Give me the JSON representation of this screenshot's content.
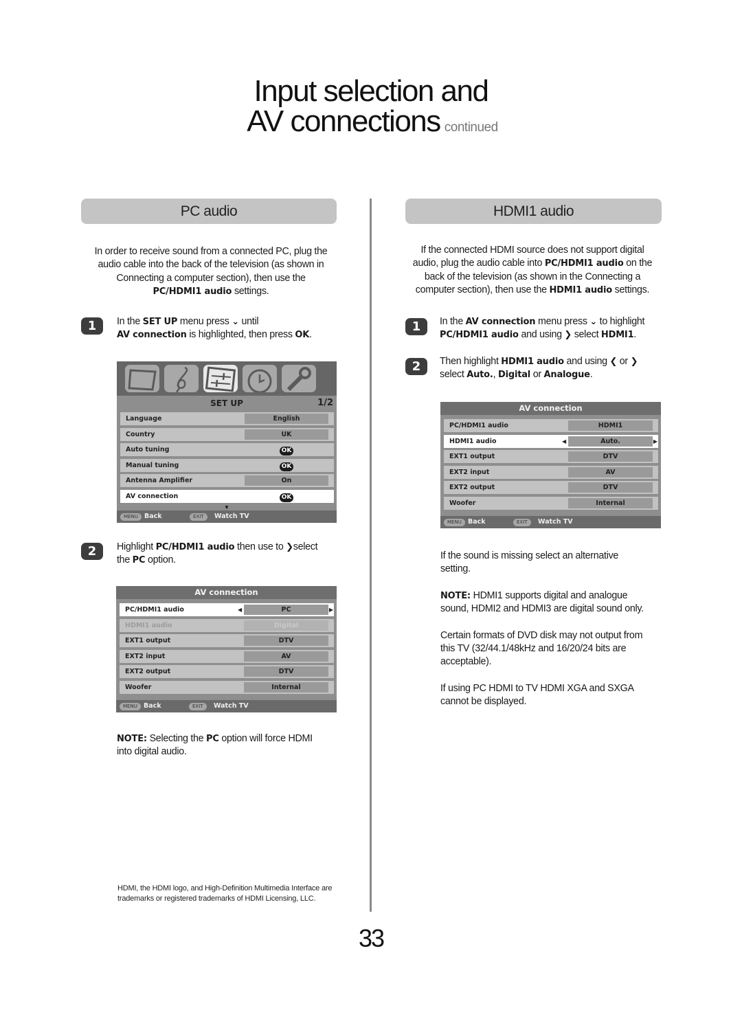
{
  "title": {
    "line1": "Input selection and",
    "line2": "AV connections",
    "suffix": "continued"
  },
  "left": {
    "heading": "PC audio",
    "intro": {
      "t1": "In order to receive sound from a connected PC, plug the",
      "t2": "audio cable into the back of the television (as shown in",
      "t3": "Connecting a computer   section), then use the",
      "b1": "PC/HDMI1 audio",
      "t4": " settings."
    },
    "step1": {
      "num": "1",
      "t1": "In the ",
      "b1": "SET UP",
      "t2": " menu press ",
      "icon": "down-chevron",
      "t3": " until",
      "b2": "AV connection",
      "t4": " is highlighted, then press  ",
      "b3": "OK",
      "t5": "."
    },
    "setup_menu": {
      "tabs": [
        "tv-icon",
        "music-clef-icon",
        "setup-sliders-icon",
        "clock-icon",
        "wrench-icon"
      ],
      "active_tab": 2,
      "title": "SET UP",
      "page": "1/2",
      "rows": [
        {
          "label": "Language",
          "value": "English"
        },
        {
          "label": "Country",
          "value": "UK"
        },
        {
          "label": "Auto tuning",
          "value": "OK"
        },
        {
          "label": "Manual tuning",
          "value": "OK"
        },
        {
          "label": "Antenna Amplifier",
          "value": "On"
        },
        {
          "label": "AV connection",
          "value": "OK",
          "highlighted": true
        }
      ],
      "footer": {
        "menu_key": "MENU",
        "menu_label": "Back",
        "exit_key": "EXIT",
        "exit_label": "Watch TV"
      }
    },
    "step2": {
      "num": "2",
      "t1": "Highlight  ",
      "b1": "PC/HDMI1 audio",
      "t2": " then use to ",
      "icon": "right-chevron",
      "t3": "select",
      "t4": "the ",
      "b2": "PC",
      "t5": " option."
    },
    "av_menu": {
      "title": "AV connection",
      "rows": [
        {
          "label": "PC/HDMI1 audio",
          "value": "PC",
          "highlighted": true
        },
        {
          "label": "HDMI1 audio",
          "value": "Digital",
          "disabled": true
        },
        {
          "label": "EXT1 output",
          "value": "DTV"
        },
        {
          "label": "EXT2 input",
          "value": "AV"
        },
        {
          "label": "EXT2 output",
          "value": "DTV"
        },
        {
          "label": "Woofer",
          "value": "Internal"
        }
      ],
      "footer": {
        "menu_key": "MENU",
        "menu_label": "Back",
        "exit_key": "EXIT",
        "exit_label": "Watch TV"
      }
    },
    "note": {
      "b1": "NOTE:",
      "t1": " Selecting the ",
      "b2": "PC",
      "t2": " option will force HDMI",
      "t3": "into digital audio."
    },
    "trademark": "HDMI, the HDMI logo, and High-Definition Multimedia Interface are trademarks or registered trademarks of HDMI Licensing, LLC."
  },
  "right": {
    "heading": "HDMI1 audio",
    "intro": {
      "t1": "If the connected HDMI source does not support digital",
      "t2": "audio, plug the audio cable into  ",
      "b1": "PC/HDMI1 audio",
      "t3": " on the",
      "t4": "back of the television (as shown in the  Connecting a",
      "t5": "computer  section), then use the ",
      "b2": "HDMI1 audio",
      "t6": " settings."
    },
    "step1": {
      "num": "1",
      "t1": "In the ",
      "b1": "AV connection",
      "t2": " menu press ",
      "icon": "down-chevron",
      "t3": " to highlight",
      "b2": "PC/HDMI1 audio",
      "t4": " and using ",
      "icon2": "right-chevron",
      "t5": " select ",
      "b3": "HDMI1",
      "t6": "."
    },
    "step2": {
      "num": "2",
      "t1": "Then highlight  ",
      "b1": "HDMI1 audio",
      "t2": " and using ",
      "icon": "left-chevron",
      "t3": " or ",
      "icon2": "right-chevron",
      "t4": "select ",
      "b2": "Auto.",
      "t5": ", ",
      "b3": "Digital",
      "t6": " or ",
      "b4": "Analogue",
      "t7": "."
    },
    "av_menu": {
      "title": "AV connection",
      "rows": [
        {
          "label": "PC/HDMI1 audio",
          "value": "HDMI1"
        },
        {
          "label": "HDMI1 audio",
          "value": "Auto.",
          "highlighted": true
        },
        {
          "label": "EXT1 output",
          "value": "DTV"
        },
        {
          "label": "EXT2 input",
          "value": "AV"
        },
        {
          "label": "EXT2 output",
          "value": "DTV"
        },
        {
          "label": "Woofer",
          "value": "Internal"
        }
      ],
      "footer": {
        "menu_key": "MENU",
        "menu_label": "Back",
        "exit_key": "EXIT",
        "exit_label": "Watch TV"
      }
    },
    "notes": {
      "p1a": "If the sound is missing select an alternative",
      "p1b": "setting.",
      "p2_bold": "NOTE:",
      "p2a": " HDMI1 supports digital and analogue",
      "p2b": "sound, HDMI2 and HDMI3 are digital sound only.",
      "p3a": "Certain formats of DVD disk may not output from",
      "p3b": "this TV (32/44.1/48kHz and 16/20/24 bits are",
      "p3c": "acceptable).",
      "p4a": "If using PC HDMI to TV HDMI XGA and SXGA",
      "p4b": "cannot be displayed."
    }
  },
  "glyphs": {
    "down": "⌄",
    "right": "❯",
    "left": "❮",
    "arrow_left_small": "◀",
    "arrow_right_small": "▶",
    "scroll_down": "▼"
  },
  "page_number": "33"
}
